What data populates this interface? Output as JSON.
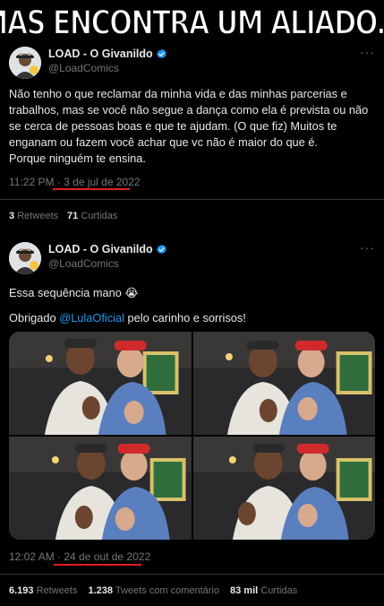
{
  "caption": "MAS ENCONTRA UM ALIADO...",
  "tweets": [
    {
      "author": "LOAD - O Givanildo",
      "handle": "@LoadComics",
      "more": "···",
      "text": "Não tenho o que reclamar da minha vida e das minhas parcerias e trabalhos, mas se você não segue a dança como ela é prevista ou não se cerca de pessoas boas e que te ajudam. (O que fiz) Muitos te enganam ou fazem você achar que vc não é maior do que é.",
      "text2": "Porque ninguém te ensina.",
      "time": "11:22 PM",
      "dot": " · ",
      "date": "3 de jul de 2022",
      "stats": [
        {
          "value": "3",
          "label": "Retweets"
        },
        {
          "value": "71",
          "label": "Curtidas"
        }
      ]
    },
    {
      "author": "LOAD - O Givanildo",
      "handle": "@LoadComics",
      "more": "···",
      "text": "Essa sequência mano 😭",
      "text_pre": "Obrigado ",
      "mention": "@LulaOficial",
      "text_post": " pelo carinho e sorrisos!",
      "time": "12:02 AM",
      "dot": " · ",
      "date": "24 de out de 2022",
      "stats": [
        {
          "value": "6.193",
          "label": "Retweets"
        },
        {
          "value": "1.238",
          "label": "Tweets com comentário"
        },
        {
          "value": "83 mil",
          "label": "Curtidas"
        }
      ]
    }
  ],
  "colors": {
    "background": "#000000",
    "text": "#e7e9ea",
    "secondary": "#71767b",
    "link": "#1d9bf0",
    "verified": "#1d9bf0",
    "highlight_underline": "#e0201f"
  },
  "icons": [
    "verified-badge-icon",
    "more-options-icon",
    "avatar"
  ]
}
